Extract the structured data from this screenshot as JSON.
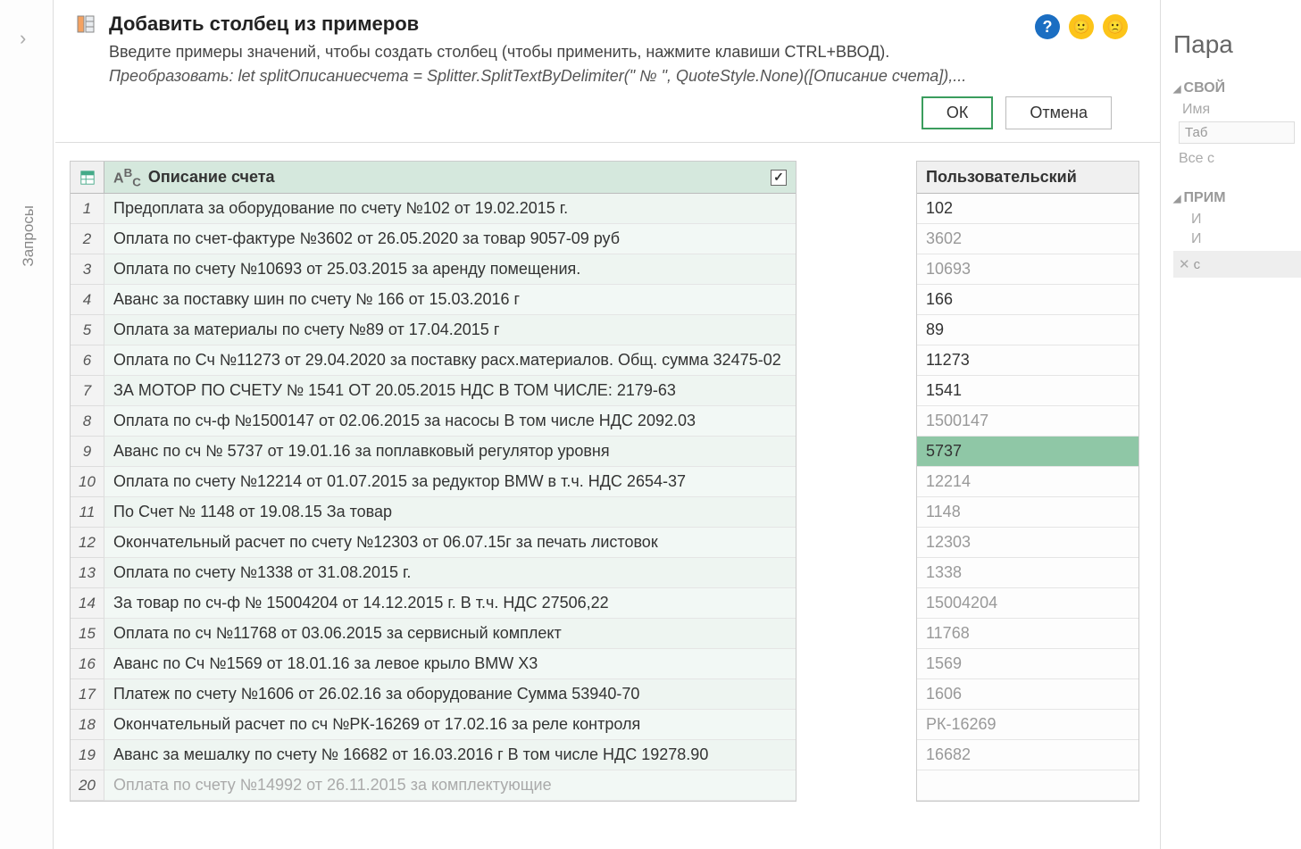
{
  "left_rail": {
    "label": "Запросы"
  },
  "banner": {
    "title": "Добавить столбец из примеров",
    "subtitle": "Введите примеры значений, чтобы создать столбец (чтобы применить, нажмите клавиши CTRL+ВВОД).",
    "formula": "Преобразовать: let splitОписаниесчета = Splitter.SplitTextByDelimiter(\" № \", QuoteStyle.None)([Описание счета]),...",
    "ok": "ОК",
    "cancel": "Отмена"
  },
  "grid": {
    "column_header": "Описание счета",
    "type_label": "ABC",
    "rows": [
      "Предоплата за оборудование по счету №102 от 19.02.2015 г.",
      "Оплата по счет-фактуре №3602 от 26.05.2020 за товар 9057-09 руб",
      "Оплата по счету №10693 от 25.03.2015 за аренду помещения.",
      "Аванс за поставку шин по счету № 166 от 15.03.2016 г",
      "Оплата за материалы по счету №89 от 17.04.2015 г",
      "Оплата по Сч №11273 от 29.04.2020 за поставку расх.материалов. Общ. сумма 32475-02",
      "ЗА МОТОР ПО СЧЕТУ № 1541 ОТ 20.05.2015 НДС В ТОМ ЧИСЛЕ: 2179-63",
      "Оплата по сч-ф №1500147 от 02.06.2015 за насосы В том числе НДС 2092.03",
      "Аванс по сч № 5737 от 19.01.16 за поплавковый регулятор уровня",
      "Оплата по счету №12214 от 01.07.2015 за редуктор BMW в т.ч. НДС 2654-37",
      "По Счет № 1148 от 19.08.15 За товар",
      "Окончательный расчет по счету №12303 от 06.07.15г за печать листовок",
      "Оплата по счету №1338 от 31.08.2015 г.",
      "За товар по сч-ф № 15004204 от 14.12.2015 г. В т.ч. НДС 27506,22",
      "Оплата по сч №11768 от 03.06.2015 за сервисный комплект",
      "Аванс по Сч №1569 от 18.01.16 за левое крыло BMW X3",
      "Платеж по счету №1606 от 26.02.16 за оборудование Сумма 53940-70",
      "Окончательный расчет по сч №РК-16269 от 17.02.16 за реле контроля",
      "Аванс за мешалку по счету № 16682 от 16.03.2016 г В том числе НДС 19278.90",
      "Оплата по счету №14992 от 26.11.2015 за комплектующие"
    ]
  },
  "custom_column": {
    "header": "Пользовательский",
    "cells": [
      {
        "v": "102",
        "state": "provided"
      },
      {
        "v": "3602",
        "state": "predicted"
      },
      {
        "v": "10693",
        "state": "predicted"
      },
      {
        "v": "166",
        "state": "provided"
      },
      {
        "v": "89",
        "state": "provided"
      },
      {
        "v": "11273",
        "state": "provided"
      },
      {
        "v": "1541",
        "state": "provided"
      },
      {
        "v": "1500147",
        "state": "predicted"
      },
      {
        "v": "5737",
        "state": "highlight"
      },
      {
        "v": "12214",
        "state": "predicted"
      },
      {
        "v": "1148",
        "state": "predicted"
      },
      {
        "v": "12303",
        "state": "predicted"
      },
      {
        "v": "1338",
        "state": "predicted"
      },
      {
        "v": "15004204",
        "state": "predicted"
      },
      {
        "v": "11768",
        "state": "predicted"
      },
      {
        "v": "1569",
        "state": "predicted"
      },
      {
        "v": "1606",
        "state": "predicted"
      },
      {
        "v": "РК-16269",
        "state": "predicted"
      },
      {
        "v": "16682",
        "state": "predicted"
      },
      {
        "v": "",
        "state": "predicted"
      }
    ]
  },
  "right_panel": {
    "title": "Пара",
    "section_props": "СВОЙ",
    "label_name": "Имя",
    "input_name_value": "Таб",
    "link_all": "Все с",
    "section_steps": "ПРИМ",
    "step1": "И",
    "step2": "И",
    "step3": "с"
  }
}
